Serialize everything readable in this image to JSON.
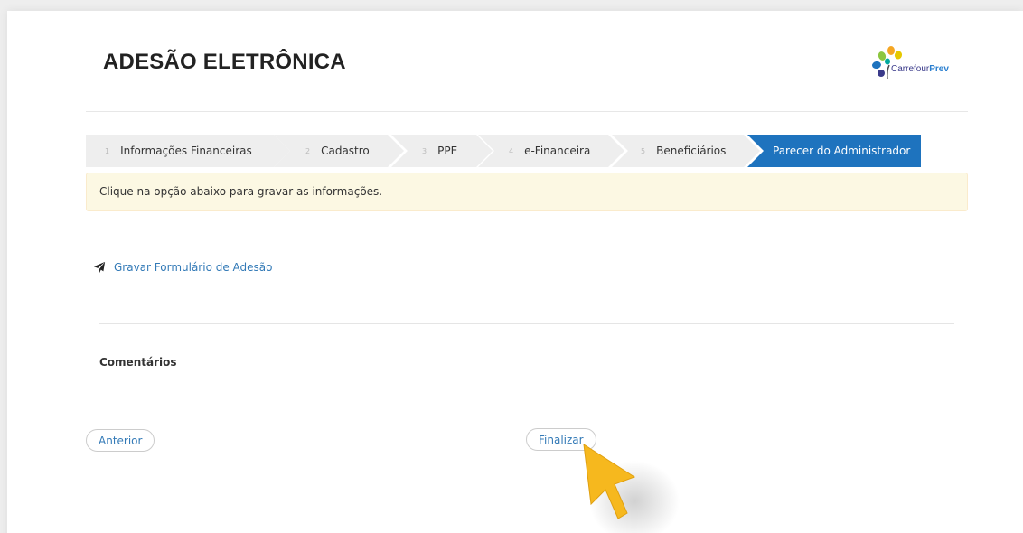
{
  "page": {
    "title": "ADESÃO ELETRÔNICA",
    "logo": {
      "text_main": "Carrefour",
      "text_bold": "Prev"
    }
  },
  "wizard": {
    "steps": [
      {
        "num": "1",
        "label": "Informações Financeiras",
        "active": false
      },
      {
        "num": "2",
        "label": "Cadastro",
        "active": false
      },
      {
        "num": "3",
        "label": "PPE",
        "active": false
      },
      {
        "num": "4",
        "label": "e-Financeira",
        "active": false
      },
      {
        "num": "5",
        "label": "Beneficiários",
        "active": false
      },
      {
        "num": "",
        "label": "Parecer do Administrador",
        "active": true
      }
    ]
  },
  "alert": {
    "text": "Clique na opção abaixo para gravar as informações."
  },
  "actions": {
    "save_form_label": "Gravar Formulário de Adesão"
  },
  "comments": {
    "label": "Comentários"
  },
  "buttons": {
    "previous": "Anterior",
    "finish": "Finalizar"
  },
  "colors": {
    "active_step": "#1e73be",
    "inactive_step": "#eeeeee",
    "link": "#337ab7",
    "alert_bg": "#fcf8e3",
    "cursor": "#f6b81e"
  },
  "icons": {
    "save": "paper-plane-icon",
    "pointer": "mouse-cursor-icon"
  }
}
